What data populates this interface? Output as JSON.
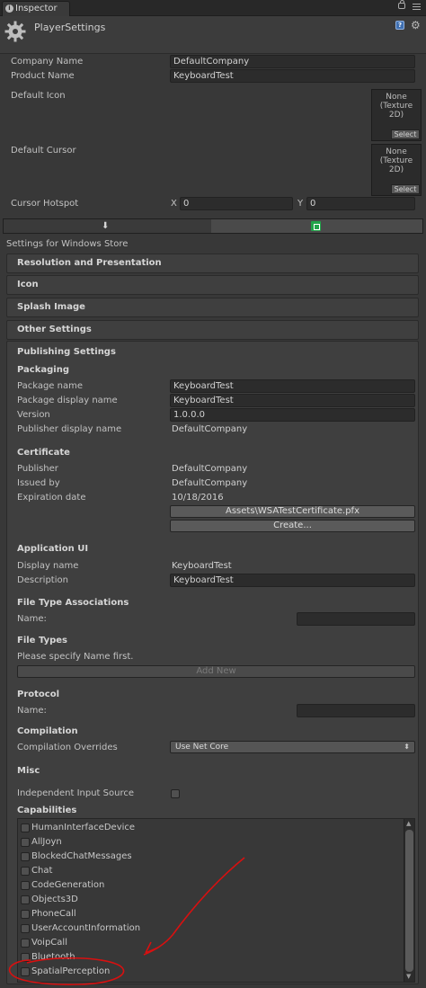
{
  "tab": {
    "label": "Inspector"
  },
  "header": {
    "title": "PlayerSettings"
  },
  "fields": {
    "company_name": {
      "label": "Company Name",
      "value": "DefaultCompany"
    },
    "product_name": {
      "label": "Product Name",
      "value": "KeyboardTest"
    },
    "default_icon": {
      "label": "Default Icon",
      "texture": "None\n(Texture\n2D)",
      "select": "Select"
    },
    "default_cursor": {
      "label": "Default Cursor",
      "texture": "None\n(Texture\n2D)",
      "select": "Select"
    },
    "cursor_hotspot": {
      "label": "Cursor Hotspot",
      "x_label": "X",
      "x_value": "0",
      "y_label": "Y",
      "y_value": "0"
    }
  },
  "platform_title": "Settings for Windows Store",
  "sections": {
    "resolution": "Resolution and Presentation",
    "icon": "Icon",
    "splash": "Splash Image",
    "other": "Other Settings",
    "publishing": "Publishing Settings"
  },
  "packaging": {
    "title": "Packaging",
    "package_name": {
      "label": "Package name",
      "value": "KeyboardTest"
    },
    "display_name": {
      "label": "Package display name",
      "value": "KeyboardTest"
    },
    "version": {
      "label": "Version",
      "value": "1.0.0.0"
    },
    "publisher_display": {
      "label": "Publisher display name",
      "value": "DefaultCompany"
    }
  },
  "certificate": {
    "title": "Certificate",
    "publisher": {
      "label": "Publisher",
      "value": "DefaultCompany"
    },
    "issued_by": {
      "label": "Issued by",
      "value": "DefaultCompany"
    },
    "expiration": {
      "label": "Expiration date",
      "value": "10/18/2016"
    },
    "file_button": "Assets\\WSATestCertificate.pfx",
    "create_button": "Create..."
  },
  "application_ui": {
    "title": "Application UI",
    "display_name": {
      "label": "Display name",
      "value": "KeyboardTest"
    },
    "description": {
      "label": "Description",
      "value": "KeyboardTest"
    }
  },
  "file_type_assoc": {
    "title": "File Type Associations",
    "name_label": "Name:",
    "name_value": ""
  },
  "file_types": {
    "title": "File Types",
    "hint": "Please specify Name first.",
    "add_button": "Add New"
  },
  "protocol": {
    "title": "Protocol",
    "name_label": "Name:",
    "name_value": ""
  },
  "compilation": {
    "title": "Compilation",
    "overrides_label": "Compilation Overrides",
    "overrides_value": "Use Net Core"
  },
  "misc": {
    "title": "Misc",
    "independent_input_label": "Independent Input Source"
  },
  "capabilities": {
    "title": "Capabilities",
    "items": [
      "HumanInterfaceDevice",
      "AllJoyn",
      "BlockedChatMessages",
      "Chat",
      "CodeGeneration",
      "Objects3D",
      "PhoneCall",
      "UserAccountInformation",
      "VoipCall",
      "Bluetooth",
      "SpatialPerception"
    ]
  },
  "colors": {
    "annotation": "#d81010",
    "platform_icon": "#22a34a"
  }
}
